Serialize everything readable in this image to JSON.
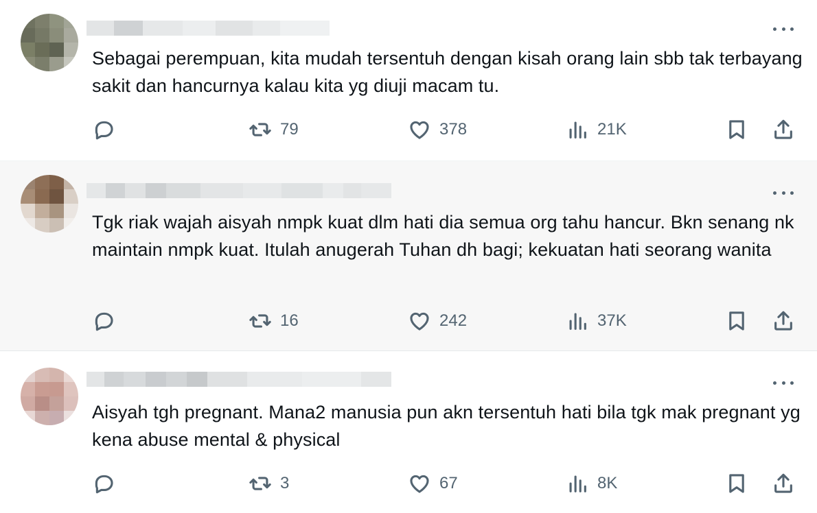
{
  "tweets": [
    {
      "text": "Sebagai perempuan, kita mudah tersentuh dengan kisah orang lain sbb tak terbayang sakit dan hancurnya kalau kita yg diuji macam tu.",
      "retweets": "79",
      "likes": "378",
      "views": "21K"
    },
    {
      "text": "Tgk riak wajah aisyah nmpk kuat dlm hati dia semua org tahu hancur. Bkn senang nk maintain nmpk kuat. Itulah anugerah Tuhan dh bagi; kekuatan hati seorang wanita",
      "retweets": "16",
      "likes": "242",
      "views": "37K"
    },
    {
      "text": "Aisyah tgh pregnant. Mana2 manusia pun akn tersentuh hati bila tgk mak pregnant yg kena abuse mental & physical",
      "retweets": "3",
      "likes": "67",
      "views": "8K"
    }
  ],
  "icons": {
    "reply": "reply-icon",
    "retweet": "retweet-icon",
    "like": "heart-icon",
    "views": "views-icon",
    "bookmark": "bookmark-icon",
    "share": "share-icon",
    "more": "more-icon"
  },
  "colors": {
    "text": "#0f1419",
    "muted": "#536471",
    "hover_bg": "#f7f7f7"
  }
}
